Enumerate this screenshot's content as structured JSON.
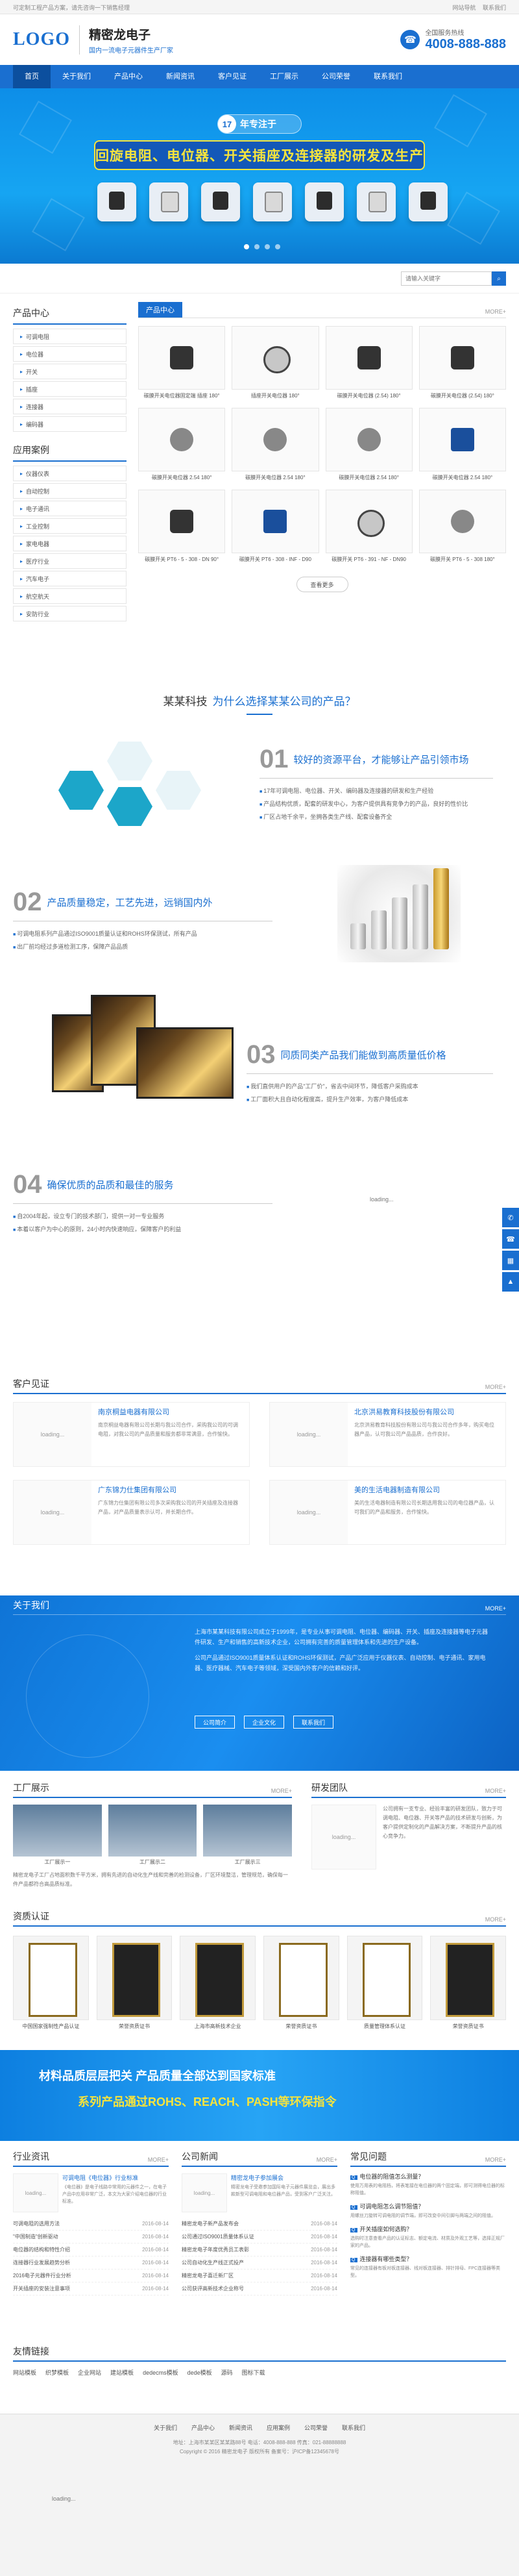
{
  "topbar": {
    "left": "可定制工程产品方案，请先咨询一下销售经理",
    "link1": "网站导航",
    "link2": "联系我们"
  },
  "header": {
    "logo": "LOGO",
    "name": "精密龙电子",
    "slogan": "国内一流电子元器件生产厂家",
    "hotline_label": "全国服务热线",
    "hotline": "4008-888-888"
  },
  "nav": [
    "首页",
    "关于我们",
    "产品中心",
    "新闻资讯",
    "客户见证",
    "工厂展示",
    "公司荣誉",
    "联系我们"
  ],
  "banner": {
    "badge_num": "17",
    "badge_text": "年专注于",
    "headline": "回旋电阻、电位器、开关插座及连接器的研发及生产"
  },
  "search": {
    "placeholder": "请输入关键字"
  },
  "sidebar": {
    "title1": "产品中心",
    "cats": [
      "可调电阻",
      "电位器",
      "开关",
      "插座",
      "连接器",
      "编码器"
    ],
    "title2": "应用案例",
    "cases": [
      "仪器仪表",
      "自动控制",
      "电子通讯",
      "工业控制",
      "家电电器",
      "医疗行业",
      "汽车电子",
      "航空航天",
      "安防行业"
    ]
  },
  "products": {
    "title": "产品中心",
    "more": "MORE+",
    "items": [
      "碳膜开关电位器固定端 插座 180°",
      "插座开关电位器 180°",
      "碳膜开关电位器 (2.54) 180°",
      "碳膜开关电位器 (2.54) 180°",
      "碳膜开关电位器 2.54 180°",
      "碳膜开关电位器 2.54 180°",
      "碳膜开关电位器 2.54 180°",
      "碳膜开关电位器 2.54 180°",
      "碳膜开关 PT6 - 5 - 308 - DN 90°",
      "碳膜开关 PT6 - 308 - INF - D90",
      "碳膜开关 PT6 - 391 - NF - DN90",
      "碳膜开关 PT6 - 5 - 308 180°"
    ],
    "view_more": "查看更多"
  },
  "why": {
    "prefix": "某某科技",
    "question": "为什么选择某某公司的产品？",
    "p1": {
      "num": "01",
      "title": "较好的资源平台，才能够让产品引领市场",
      "lines": [
        "17年可调电阻、电位器、开关、编码器及连接器的研发和生产经验",
        "产品结构优质，配套的研发中心，为客户提供具有竞争力的产品，良好的性价比",
        "厂区占地千余平，坐拥各类生产线、配套设备齐全"
      ]
    },
    "p2": {
      "num": "02",
      "title": "产品质量稳定，工艺先进，远销国内外",
      "lines": [
        "可调电阻系列产品通过ISO9001质量认证和ROHS环保测试，所有产品",
        "出厂前均经过多道检测工序，保障产品品质"
      ]
    },
    "p3": {
      "num": "03",
      "title": "同质同类产品我们能做到高质量低价格",
      "lines": [
        "我们直供用户的产品\"工厂价\"，省去中间环节，降低客户采购成本",
        "工厂面积大且自动化程度高，提升生产效率，为客户降低成本"
      ]
    },
    "p4": {
      "num": "04",
      "title": "确保优质的品质和最佳的服务",
      "lines": [
        "自2004年起，设立专门的技术部门，提供一对一专业服务",
        "本着以客户为中心的原则，24小时内快速响应，保障客户的利益"
      ]
    },
    "loading": "loading..."
  },
  "testimonials": {
    "title": "客户见证",
    "more": "MORE+",
    "loading": "loading...",
    "items": [
      {
        "name": "南京桐益电器有限公司",
        "desc": "南京桐益电器有限公司长期与我公司合作，采购我公司的可调电阻，对我公司的产品质量和服务都非常满意，合作愉快。"
      },
      {
        "name": "北京洪易教育科技股份有限公司",
        "desc": "北京洪易教育科技股份有限公司与我公司合作多年，购买电位器产品，认可我公司产品品质，合作良好。"
      },
      {
        "name": "广东锦力仕集团有限公司",
        "desc": "广东锦力仕集团有限公司多次采购我公司的开关插座及连接器产品，对产品质量表示认可，并长期合作。"
      },
      {
        "name": "美的生活电器制造有限公司",
        "desc": "美的生活电器制造有限公司长期选用我公司的电位器产品，认可我们的产品和服务，合作愉快。"
      }
    ]
  },
  "about": {
    "title": "关于我们",
    "more": "MORE+",
    "text1": "上海市某某科技有限公司成立于1999年，是专业从事可调电阻、电位器、编码器、开关、插座及连接器等电子元器件研发、生产和销售的高新技术企业，公司拥有完善的质量管理体系和先进的生产设备。",
    "text2": "公司产品通过ISO9001质量体系认证和ROHS环保测试，产品广泛应用于仪器仪表、自动控制、电子通讯、家用电器、医疗器械、汽车电子等领域，深受国内外客户的信赖和好评。",
    "btns": [
      "公司简介",
      "企业文化",
      "联系我们"
    ]
  },
  "factory": {
    "title": "工厂展示",
    "more": "MORE+",
    "captions": [
      "工厂展示一",
      "工厂展示二",
      "工厂展示三"
    ],
    "desc": "精密龙电子工厂占地面积数千平方米，拥有先进的自动化生产线和完善的检测设备，厂区环境整洁，管理规范，确保每一件产品都符合高品质标准。"
  },
  "team": {
    "title": "研发团队",
    "more": "MORE+",
    "loading": "loading...",
    "desc": "公司拥有一支专业、经验丰富的研发团队，致力于可调电阻、电位器、开关等产品的技术研发与创新，为客户提供定制化的产品解决方案，不断提升产品的核心竞争力。"
  },
  "certs": {
    "title": "资质认证",
    "more": "MORE+",
    "items": [
      "中国国家强制性产品认证",
      "荣誉资质证书",
      "上海市高新技术企业",
      "荣誉资质证书",
      "质量管理体系认证",
      "荣誉资质证书"
    ]
  },
  "cta": {
    "line1": "材料品质层层把关 产品质量全部达到国家标准",
    "line2": "系列产品通过ROHS、REACH、PASH等环保指令"
  },
  "news": {
    "industry": {
      "title": "行业资讯",
      "more": "MORE+",
      "loading": "loading...",
      "feat_title": "可调电阻《电位器》行业标准",
      "feat_desc": "《电位器》是电子线路中常用的元器件之一，在电子产品中应用非常广泛，本文为大家介绍电位器的行业标准。",
      "list": [
        {
          "t": "可调电阻的选用方法",
          "d": "2016-08-14"
        },
        {
          "t": "\"中国制造\"创新驱动",
          "d": "2016-08-14"
        },
        {
          "t": "电位器的结构和特性介绍",
          "d": "2016-08-14"
        },
        {
          "t": "连接器行业发展趋势分析",
          "d": "2016-08-14"
        },
        {
          "t": "2016电子元器件行业分析",
          "d": "2016-08-14"
        },
        {
          "t": "开关插座的安装注意事项",
          "d": "2016-08-14"
        }
      ]
    },
    "company": {
      "title": "公司新闻",
      "more": "MORE+",
      "loading": "loading...",
      "feat_title": "精密龙电子参加展会",
      "feat_desc": "精密龙电子受邀参加国际电子元器件展览会，展出多款新型可调电阻和电位器产品，受到客户广泛关注。",
      "list": [
        {
          "t": "精密龙电子新产品发布会",
          "d": "2016-08-14"
        },
        {
          "t": "公司通过ISO9001质量体系认证",
          "d": "2016-08-14"
        },
        {
          "t": "精密龙电子年度优秀员工表彰",
          "d": "2016-08-14"
        },
        {
          "t": "公司自动化生产线正式投产",
          "d": "2016-08-14"
        },
        {
          "t": "精密龙电子喜迁新厂区",
          "d": "2016-08-14"
        },
        {
          "t": "公司获评高新技术企业称号",
          "d": "2016-08-14"
        }
      ]
    },
    "faq": {
      "title": "常见问题",
      "more": "MORE+",
      "items": [
        {
          "q": "电位器的阻值怎么测量？",
          "a": "使用万用表的电阻档，将表笔接在电位器的两个固定端，即可测得电位器的标称阻值。"
        },
        {
          "q": "可调电阻怎么调节阻值？",
          "a": "用螺丝刀旋转可调电阻的调节端，即可改变中间引脚与两端之间的阻值。"
        },
        {
          "q": "开关插座如何选购？",
          "a": "选购时注意查看产品的认证标志、额定电流、材质及外观工艺等，选择正规厂家的产品。"
        },
        {
          "q": "连接器有哪些类型？",
          "a": "常见的连接器有板对板连接器、线对板连接器、排针排母、FPC连接器等类型。"
        }
      ]
    }
  },
  "friend_links": {
    "title": "友情链接",
    "items": [
      "网站模板",
      "织梦模板",
      "企业网站",
      "建站模板",
      "dedecms模板",
      "dede模板",
      "源码",
      "图标下载"
    ]
  },
  "footer": {
    "nav": [
      "关于我们",
      "产品中心",
      "新闻资讯",
      "应用案例",
      "公司荣誉",
      "联系我们"
    ],
    "addr": "地址：上海市某某区某某路88号 电话：4008-888-888 传真：021-88888888",
    "copy": "Copyright © 2016 精密龙电子 版权所有 备案号：沪ICP备12345678号",
    "loading": "loading..."
  }
}
